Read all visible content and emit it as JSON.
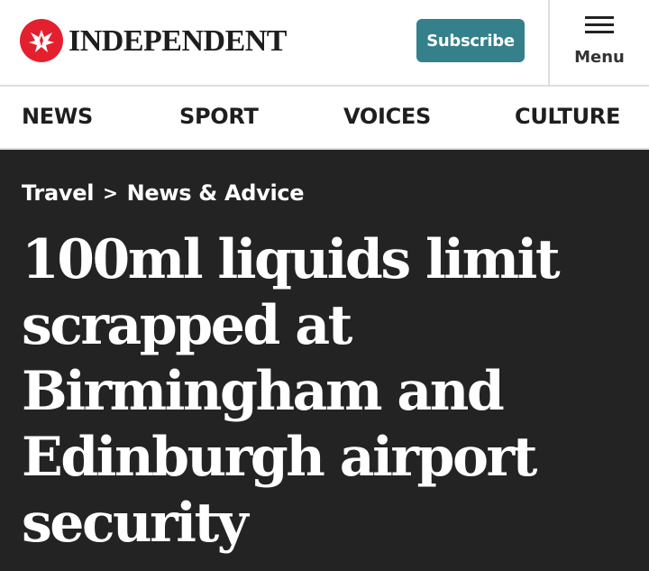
{
  "header": {
    "logo_text": "INDEPENDENT",
    "logo_icon": "eagle-icon",
    "subscribe_label": "Subscribe",
    "menu_label": "Menu",
    "menu_icon": "hamburger-icon"
  },
  "nav": {
    "items": [
      {
        "label": "NEWS"
      },
      {
        "label": "SPORT"
      },
      {
        "label": "VOICES"
      },
      {
        "label": "CULTURE"
      }
    ]
  },
  "breadcrumb": {
    "section": "Travel",
    "separator": ">",
    "subsection": "News & Advice"
  },
  "article": {
    "headline": "100ml liquids limit scrapped at Birmingham and Edinburgh airport security"
  },
  "colors": {
    "brand_red": "#e5202e",
    "subscribe_teal": "#34808b",
    "hero_background": "#232323"
  }
}
